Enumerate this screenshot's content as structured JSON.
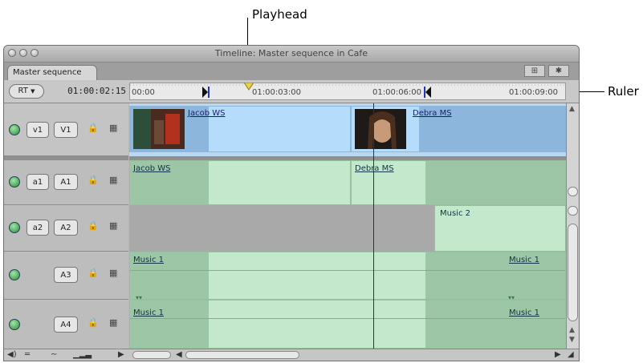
{
  "annotations": {
    "playhead": "Playhead",
    "ruler": "Ruler"
  },
  "window": {
    "title": "Timeline: Master sequence in Cafe",
    "tab": "Master sequence"
  },
  "controls": {
    "rt": "RT",
    "timecode": "01:00:02:15"
  },
  "ruler": {
    "labels": [
      "00:00",
      "01:00:03:00",
      "01:00:06:00",
      "01:00:09:00"
    ]
  },
  "tracks": {
    "video": [
      {
        "source": "v1",
        "dest": "V1"
      }
    ],
    "audio": [
      {
        "source": "a1",
        "dest": "A1"
      },
      {
        "source": "a2",
        "dest": "A2"
      },
      {
        "source": "",
        "dest": "A3"
      },
      {
        "source": "",
        "dest": "A4"
      }
    ]
  },
  "clips": {
    "v1": [
      "Jacob WS",
      "Debra MS"
    ],
    "a1": [
      "Jacob WS",
      "Debra MS"
    ],
    "a2": [
      "Music 2"
    ],
    "a3": [
      "Music 1",
      "Music 1"
    ],
    "a4": [
      "Music 1",
      "Music 1"
    ]
  },
  "colors": {
    "video_clip": "#b6dcfb",
    "audio_clip": "#c3e8cc",
    "playhead_marker": "#e8d24a",
    "in_out_marker": "#2236b8"
  }
}
